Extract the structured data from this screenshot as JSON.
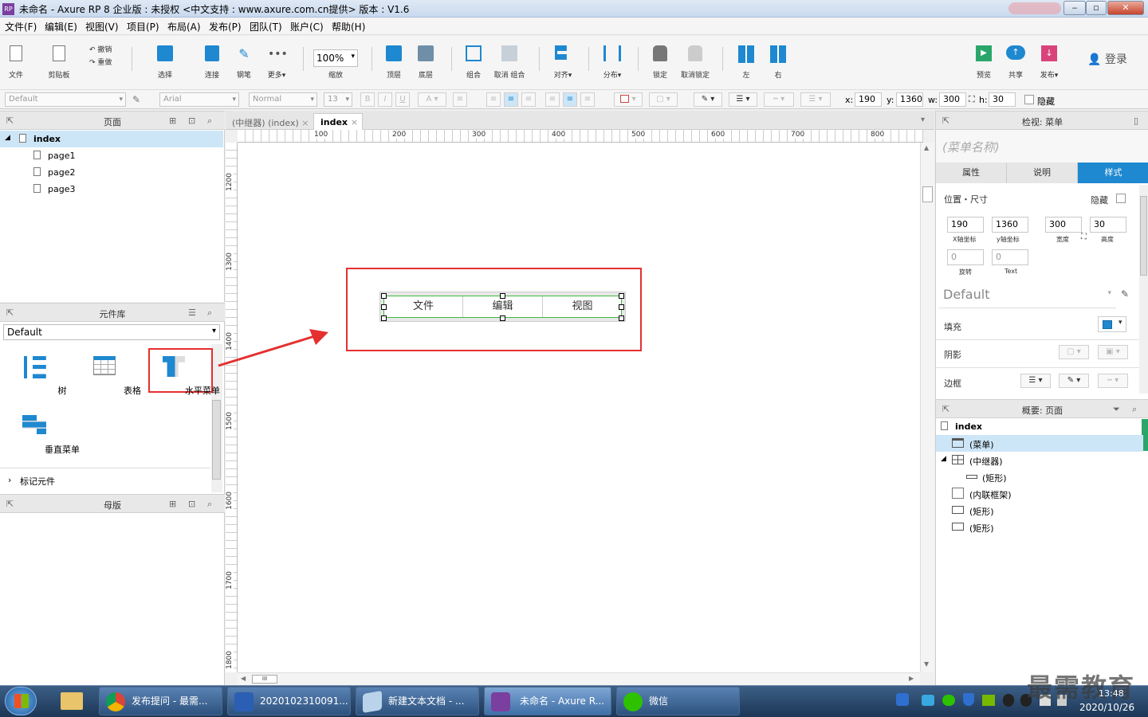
{
  "window": {
    "title": "未命名 - Axure RP 8 企业版 : 未授权     <中文支持 : www.axure.com.cn提供> 版本 : V1.6",
    "app_icon": "RP"
  },
  "menu": [
    "文件(F)",
    "编辑(E)",
    "视图(V)",
    "项目(P)",
    "布局(A)",
    "发布(P)",
    "团队(T)",
    "账户(C)",
    "帮助(H)"
  ],
  "toolbar": {
    "file": "文件",
    "clipboard": "剪贴板",
    "undo": "撤销",
    "redo": "重做",
    "select": "选择",
    "connect": "连接",
    "pen": "钢笔",
    "more": "更多▾",
    "zoom_value": "100%",
    "zoom": "缩放",
    "top": "顶层",
    "bottom": "底层",
    "group": "组合",
    "ungroup": "取消 组合",
    "align": "对齐▾",
    "distribute": "分布▾",
    "lock": "锁定",
    "unlock": "取消锁定",
    "left": "左",
    "right": "右",
    "preview": "预览",
    "share": "共享",
    "publish": "发布▾",
    "login": "登录"
  },
  "format_bar": {
    "style": "Default",
    "font": "Arial",
    "weight": "Normal",
    "size": "13",
    "x_label": "x:",
    "x": "190",
    "y_label": "y:",
    "y": "1360",
    "w_label": "w:",
    "w": "300",
    "h_label": "h:",
    "h": "30",
    "hide": "隐藏"
  },
  "pages_panel": {
    "title": "页面",
    "root": "index",
    "children": [
      "page1",
      "page2",
      "page3"
    ]
  },
  "library_panel": {
    "title": "元件库",
    "library": "Default",
    "widgets": [
      "树",
      "表格",
      "水平菜单",
      "垂直菜单"
    ],
    "marker": "标记元件"
  },
  "masters_panel": {
    "title": "母版"
  },
  "canvas": {
    "tabs": [
      "(中继器) (index)",
      "index"
    ],
    "h_ruler": [
      "100",
      "200",
      "300",
      "400",
      "500",
      "600",
      "700",
      "800"
    ],
    "v_ruler": [
      "1200",
      "1300",
      "1400",
      "1500",
      "1600",
      "1700",
      "1800"
    ],
    "menu_items": [
      "文件",
      "编辑",
      "视图"
    ]
  },
  "inspector": {
    "title": "检视: 菜单",
    "name": "(菜单名称)",
    "tabs": [
      "属性",
      "说明",
      "样式"
    ],
    "section": "位置・尺寸",
    "hide": "隐藏",
    "x": "190",
    "x_label": "X轴坐标",
    "y": "1360",
    "y_label": "y轴坐标",
    "w": "300",
    "w_label": "宽度",
    "h": "30",
    "h_label": "高度",
    "rotate": "0",
    "rotate_label": "旋转",
    "text_rotate": "0",
    "text_label": "Text",
    "style": "Default",
    "fill": "填充",
    "shadow": "阴影",
    "border": "边框",
    "accent": "#1e88d0"
  },
  "outline": {
    "title": "概要: 页面",
    "items": [
      "index",
      "(菜单)",
      "(中继器)",
      "(矩形)",
      "(内联框架)",
      "(矩形)",
      "(矩形)"
    ]
  },
  "taskbar": {
    "items": [
      "发布提问 - 最需...",
      "2020102310091...",
      "新建文本文档 - ...",
      "未命名 - Axure R...",
      "微信"
    ],
    "clock_time": "13:48",
    "clock_date": "2020/10/26",
    "watermark": "最需教育"
  }
}
